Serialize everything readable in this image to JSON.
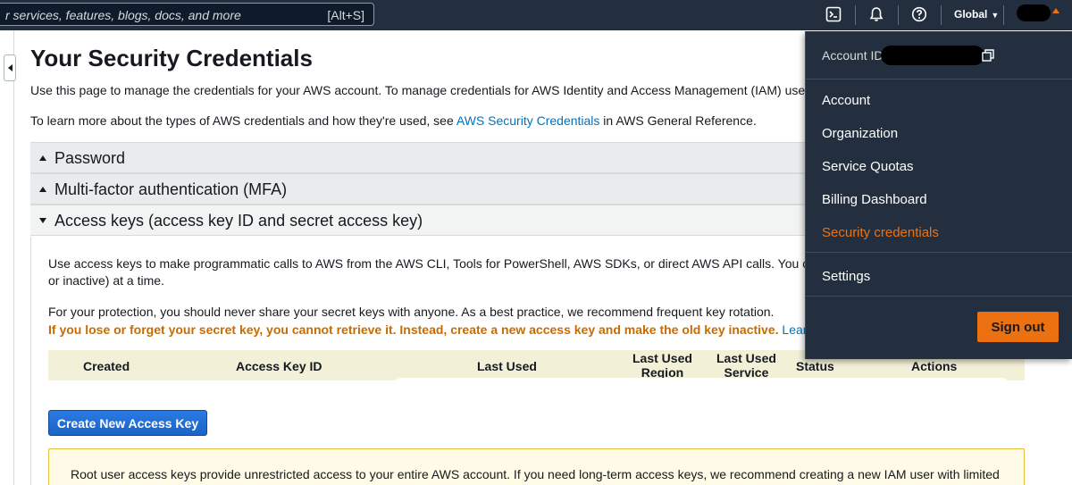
{
  "topnav": {
    "search_placeholder": "r services, features, blogs, docs, and more",
    "search_shortcut": "[Alt+S]",
    "region_label": "Global",
    "region_caret": "▼"
  },
  "page": {
    "title": "Your Security Credentials",
    "intro_line1": "Use this page to manage the credentials for your AWS account. To manage credentials for AWS Identity and Access Management (IAM) users, use",
    "intro_line2_pre": "To learn more about the types of AWS credentials and how they're used, see ",
    "intro_line2_link": "AWS Security Credentials",
    "intro_line2_post": " in AWS General Reference."
  },
  "sections": {
    "password": "Password",
    "mfa": "Multi-factor authentication (MFA)",
    "access_keys": "Access keys (access key ID and secret access key)"
  },
  "access_keys": {
    "para1_line1": "Use access keys to make programmatic calls to AWS from the AWS CLI, Tools for PowerShell, AWS SDKs, or direct AWS API calls. You can hav",
    "para1_line2": "or inactive) at a time.",
    "para2": "For your protection, you should never share your secret keys with anyone. As a best practice, we recommend frequent key rotation.",
    "warning": "If you lose or forget your secret key, you cannot retrieve it. Instead, create a new access key and make the old key inactive.",
    "learn_more": "Learn more",
    "table_headers": {
      "created": "Created",
      "access_key_id": "Access Key ID",
      "last_used": "Last Used",
      "last_used_region_1": "Last Used",
      "last_used_region_2": "Region",
      "last_used_service_1": "Last Used",
      "last_used_service_2": "Service",
      "status": "Status",
      "actions": "Actions"
    },
    "create_button": "Create New Access Key",
    "alert_text": "Root user access keys provide unrestricted access to your entire AWS account. If you need long-term access keys, we recommend creating a new IAM user with limited"
  },
  "account_menu": {
    "account_id_label": "Account ID:",
    "items": [
      "Account",
      "Organization",
      "Service Quotas",
      "Billing Dashboard",
      "Security credentials",
      "Settings"
    ],
    "active_item": "Security credentials",
    "sign_out": "Sign out"
  },
  "colors": {
    "nav_bg": "#232f3e",
    "accent_orange": "#ec7211",
    "link_blue": "#0073bb",
    "warning_text": "#c86b00",
    "primary_button": "#1f6bd1"
  }
}
